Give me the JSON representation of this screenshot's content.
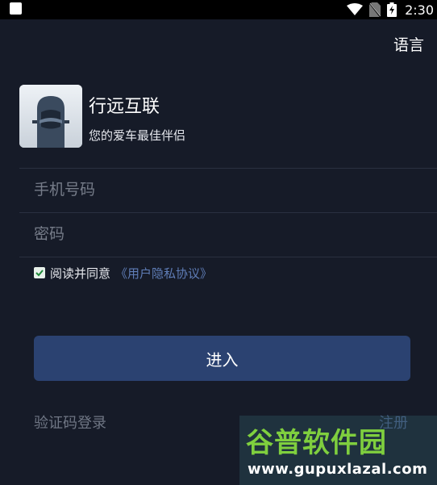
{
  "status_bar": {
    "time": "2:30"
  },
  "header": {
    "language_label": "语言"
  },
  "app": {
    "name": "行远互联",
    "slogan": "您的爱车最佳伴侣"
  },
  "form": {
    "phone_placeholder": "手机号码",
    "phone_value": "",
    "password_placeholder": "密码",
    "password_value": "",
    "agree_text": "阅读并同意",
    "agree_link": "《用户隐私协议》",
    "agree_checked": true,
    "enter_label": "进入",
    "sms_login_label": "验证码登录",
    "register_label": "注册"
  },
  "watermark": {
    "title": "谷普软件园",
    "url": "www.gupuxlazal.com"
  },
  "colors": {
    "background": "#161b28",
    "button": "#2b4271",
    "link": "#5f7db7",
    "check": "#1f8a3a"
  }
}
